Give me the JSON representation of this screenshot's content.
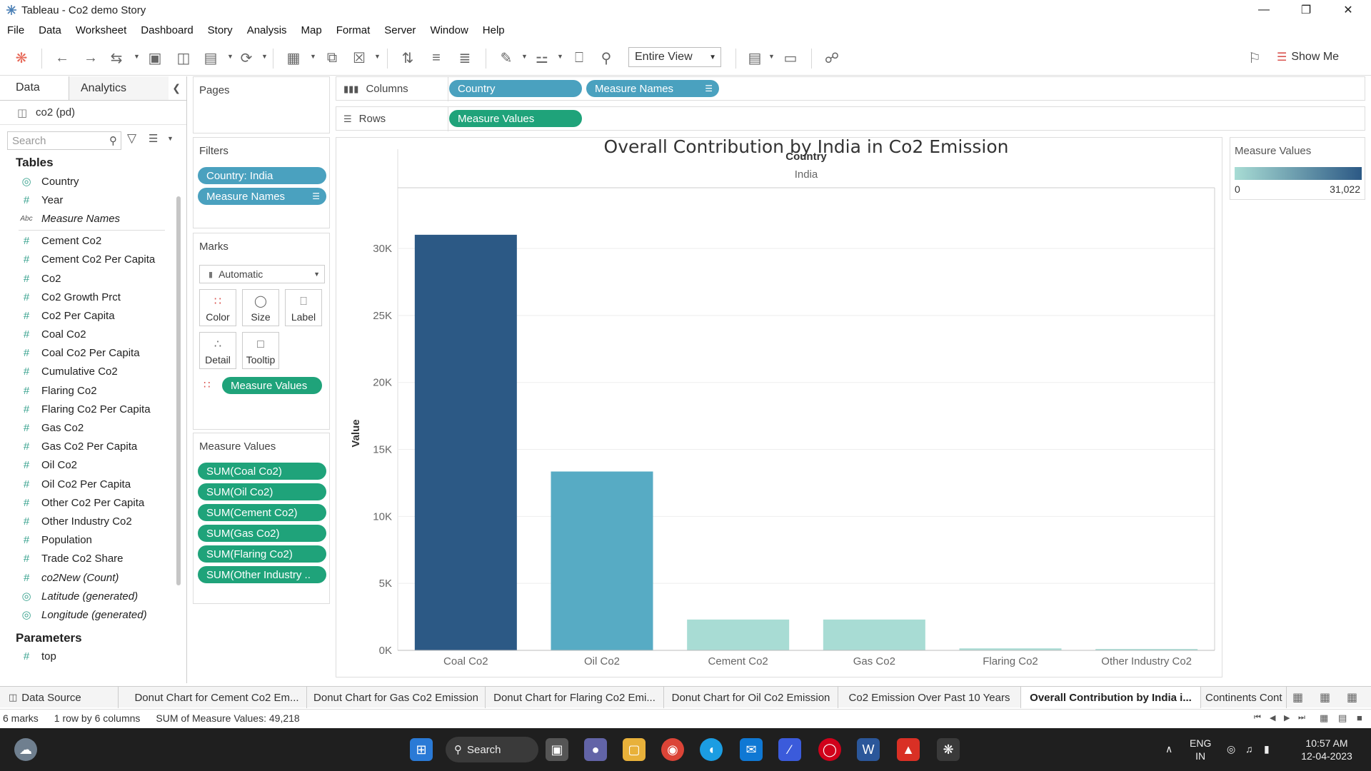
{
  "window": {
    "title": "Tableau - Co2 demo Story"
  },
  "menu": [
    "File",
    "Data",
    "Worksheet",
    "Dashboard",
    "Story",
    "Analysis",
    "Map",
    "Format",
    "Server",
    "Window",
    "Help"
  ],
  "toolbar": {
    "view_option": "Entire View",
    "show_me": "Show Me"
  },
  "data_pane": {
    "tab_data": "Data",
    "tab_analytics": "Analytics",
    "datasource": "co2 (pd)",
    "search_placeholder": "Search",
    "tables_heading": "Tables",
    "fields": [
      {
        "name": "Country",
        "type": "geo",
        "italic": false
      },
      {
        "name": "Year",
        "type": "num",
        "italic": false
      },
      {
        "name": "Measure Names",
        "type": "abc",
        "italic": true
      },
      {
        "name": "Cement Co2",
        "type": "num",
        "italic": false
      },
      {
        "name": "Cement Co2 Per Capita",
        "type": "num",
        "italic": false
      },
      {
        "name": "Co2",
        "type": "num",
        "italic": false
      },
      {
        "name": "Co2 Growth Prct",
        "type": "num",
        "italic": false
      },
      {
        "name": "Co2 Per Capita",
        "type": "num",
        "italic": false
      },
      {
        "name": "Coal Co2",
        "type": "num",
        "italic": false
      },
      {
        "name": "Coal Co2 Per Capita",
        "type": "num",
        "italic": false
      },
      {
        "name": "Cumulative Co2",
        "type": "num",
        "italic": false
      },
      {
        "name": "Flaring Co2",
        "type": "num",
        "italic": false
      },
      {
        "name": "Flaring Co2 Per Capita",
        "type": "num",
        "italic": false
      },
      {
        "name": "Gas Co2",
        "type": "num",
        "italic": false
      },
      {
        "name": "Gas Co2 Per Capita",
        "type": "num",
        "italic": false
      },
      {
        "name": "Oil Co2",
        "type": "num",
        "italic": false
      },
      {
        "name": "Oil Co2 Per Capita",
        "type": "num",
        "italic": false
      },
      {
        "name": "Other Co2 Per Capita",
        "type": "num",
        "italic": false
      },
      {
        "name": "Other Industry Co2",
        "type": "num",
        "italic": false
      },
      {
        "name": "Population",
        "type": "num",
        "italic": false
      },
      {
        "name": "Trade Co2 Share",
        "type": "num",
        "italic": false
      },
      {
        "name": "co2New (Count)",
        "type": "num",
        "italic": true
      },
      {
        "name": "Latitude (generated)",
        "type": "geo",
        "italic": true
      },
      {
        "name": "Longitude (generated)",
        "type": "geo",
        "italic": true
      }
    ],
    "parameters_heading": "Parameters",
    "parameters": [
      "top"
    ]
  },
  "pages": {
    "heading": "Pages"
  },
  "filters": {
    "heading": "Filters",
    "pills": [
      "Country: India",
      "Measure Names"
    ]
  },
  "marks": {
    "heading": "Marks",
    "type": "Automatic",
    "buttons": [
      "Color",
      "Size",
      "Label",
      "Detail",
      "Tooltip"
    ],
    "color_pill": "Measure Values"
  },
  "measure_values_card": {
    "heading": "Measure Values",
    "pills": [
      "SUM(Coal Co2)",
      "SUM(Oil Co2)",
      "SUM(Cement Co2)",
      "SUM(Gas Co2)",
      "SUM(Flaring Co2)",
      "SUM(Other Industry .."
    ]
  },
  "columns_shelf": {
    "label": "Columns",
    "pills": [
      "Country",
      "Measure Names"
    ]
  },
  "rows_shelf": {
    "label": "Rows",
    "pills": [
      "Measure Values"
    ]
  },
  "legend": {
    "title": "Measure Values",
    "min": "0",
    "max": "31,022",
    "color_low": "#a8dcd4",
    "color_high": "#2c5985"
  },
  "chart_data": {
    "type": "bar",
    "title": "Overall Contribution by India in Co2 Emission",
    "header_field": "Country",
    "header_value": "India",
    "ylabel": "Value",
    "xlabel": "",
    "categories": [
      "Coal Co2",
      "Oil Co2",
      "Cement Co2",
      "Gas Co2",
      "Flaring Co2",
      "Other Industry Co2"
    ],
    "values": [
      31022,
      13350,
      2300,
      2300,
      146,
      100
    ],
    "ylim": [
      0,
      32400
    ],
    "yticks": [
      0,
      5000,
      10000,
      15000,
      20000,
      25000,
      30000
    ],
    "ytick_labels": [
      "0K",
      "5K",
      "10K",
      "15K",
      "20K",
      "25K",
      "30K"
    ],
    "grid": true,
    "colors": [
      "#2c5985",
      "#57abc4",
      "#a8dcd4",
      "#a8dcd4",
      "#a8dcd4",
      "#a8dcd4"
    ]
  },
  "sheet_tabs": {
    "data_source": "Data Source",
    "tabs": [
      "Donut Chart for Cement Co2 Em...",
      "Donut Chart for Gas Co2 Emission",
      "Donut Chart for Flaring Co2 Emi...",
      "Donut Chart for Oil Co2 Emission",
      "Co2 Emission Over Past 10 Years",
      "Overall Contribution by India i...",
      "Continents Cont"
    ],
    "active_index": 5
  },
  "status": {
    "marks": "6 marks",
    "dims": "1 row by 6 columns",
    "sum": "SUM of Measure Values: 49,218"
  },
  "taskbar": {
    "search": "Search",
    "lang1": "ENG",
    "lang2": "IN",
    "time": "10:57 AM",
    "date": "12-04-2023"
  }
}
